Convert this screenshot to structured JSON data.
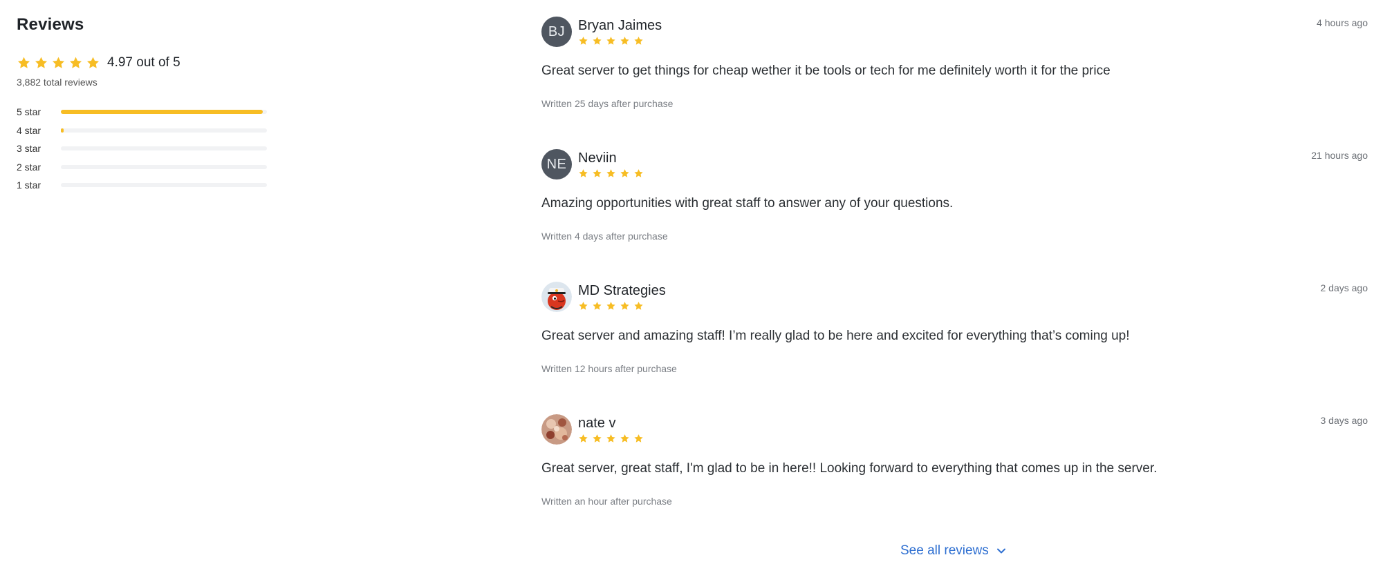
{
  "summary": {
    "title": "Reviews",
    "overall": "4.97 out of 5",
    "total": "3,882 total reviews",
    "distribution": [
      {
        "label": "5 star",
        "fraction": 0.98
      },
      {
        "label": "4 star",
        "fraction": 0.01
      },
      {
        "label": "3 star",
        "fraction": 0
      },
      {
        "label": "2 star",
        "fraction": 0
      },
      {
        "label": "1 star",
        "fraction": 0
      }
    ]
  },
  "colors": {
    "star": "#f7bd24",
    "link": "#2e6fd1",
    "avatar_bg": "#4f5660"
  },
  "reviews": [
    {
      "avatar": "BJ",
      "name": "Bryan Jaimes",
      "rating": 5,
      "time": "4 hours ago",
      "text": "Great server to get things for cheap wether it be tools or tech for me definitely worth it for the price",
      "written": "Written 25 days after purchase"
    },
    {
      "avatar": "NE",
      "name": "Neviin",
      "rating": 5,
      "time": "21 hours ago",
      "text": "Amazing opportunities with great staff to answer any of your questions.",
      "written": "Written 4 days after purchase"
    },
    {
      "avatar_icon": "cartoon-captain-avatar-icon",
      "name": "MD Strategies",
      "rating": 5,
      "time": "2 days ago",
      "text": "Great server and amazing staff! I’m really glad to be here and excited for everything that’s coming up!",
      "written": "Written 12 hours after purchase"
    },
    {
      "avatar_icon": "photo-avatar-icon",
      "name": "nate v",
      "rating": 5,
      "time": "3 days ago",
      "text": "Great server, great staff, I'm glad to be in here!! Looking forward to everything that comes up in the server.",
      "written": "Written an hour after purchase"
    }
  ],
  "see_all": {
    "label": "See all reviews",
    "icon": "chevron-down-icon"
  }
}
